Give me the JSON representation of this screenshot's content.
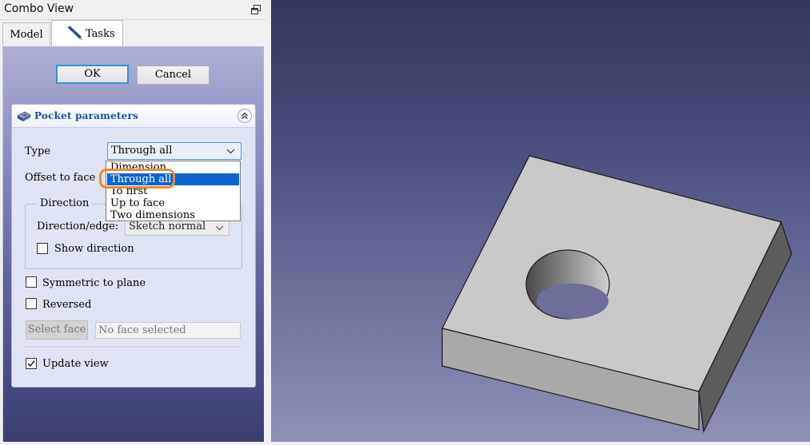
{
  "combo": {
    "title": "Combo View",
    "tabs": [
      {
        "label": "Model"
      },
      {
        "label": "Tasks"
      }
    ]
  },
  "dialog": {
    "ok_label": "OK",
    "cancel_label": "Cancel"
  },
  "pocket": {
    "title": "Pocket parameters",
    "type_label": "Type",
    "type_value": "Through all",
    "offset_label": "Offset to face",
    "type_options": [
      "Dimension",
      "Through all",
      "To first",
      "Up to face",
      "Two dimensions"
    ],
    "selected_option": "Through all",
    "direction": {
      "legend": "Direction",
      "edge_label": "Direction/edge:",
      "edge_value": "Sketch normal",
      "show_direction_label": "Show direction",
      "show_direction_checked": false
    },
    "symmetric_label": "Symmetric to plane",
    "symmetric_checked": false,
    "reversed_label": "Reversed",
    "reversed_checked": false,
    "select_face_label": "Select face",
    "face_field_value": "No face selected",
    "update_view_label": "Update view",
    "update_view_checked": true
  },
  "colors": {
    "accent": "#0a64d1",
    "highlight_ring": "#f08a2a",
    "section_title": "#1a4fa3"
  }
}
